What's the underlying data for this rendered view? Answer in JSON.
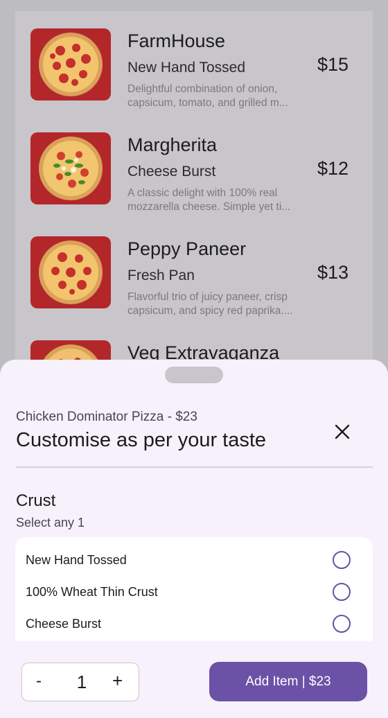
{
  "menu": {
    "items": [
      {
        "name": "FarmHouse",
        "crust": "New Hand Tossed",
        "price": "$15",
        "description": "Delightful combination of onion, capsicum, tomato, and grilled m...",
        "image": "pepperoni-pizza-icon"
      },
      {
        "name": "Margherita",
        "crust": "Cheese Burst",
        "price": "$12",
        "description": "A classic delight with 100% real mozzarella cheese. Simple yet ti...",
        "image": "margherita-pizza-icon"
      },
      {
        "name": "Peppy Paneer",
        "crust": "Fresh Pan",
        "price": "$13",
        "description": "Flavorful trio of juicy paneer, crisp capsicum, and spicy red paprika....",
        "image": "pepperoni-pizza-icon"
      },
      {
        "name": "Veg Extravaganza",
        "crust": "",
        "price": "",
        "description": "",
        "image": "veg-pizza-icon"
      }
    ]
  },
  "sheet": {
    "subtitle": "Chicken Dominator Pizza - $23",
    "title": "Customise as per your taste",
    "close_icon": "close-icon",
    "crust_heading": "Crust",
    "crust_hint": "Select any 1",
    "options": [
      {
        "label": "New Hand Tossed",
        "selected": false
      },
      {
        "label": "100% Wheat Thin Crust",
        "selected": false
      },
      {
        "label": "Cheese Burst",
        "selected": false
      }
    ],
    "quantity": {
      "minus": "-",
      "value": "1",
      "plus": "+"
    },
    "add_button": "Add Item | $23"
  },
  "colors": {
    "accent": "#6b52a6",
    "sheet_bg": "#f6f1fb",
    "pizza_bg": "#b3272a"
  }
}
